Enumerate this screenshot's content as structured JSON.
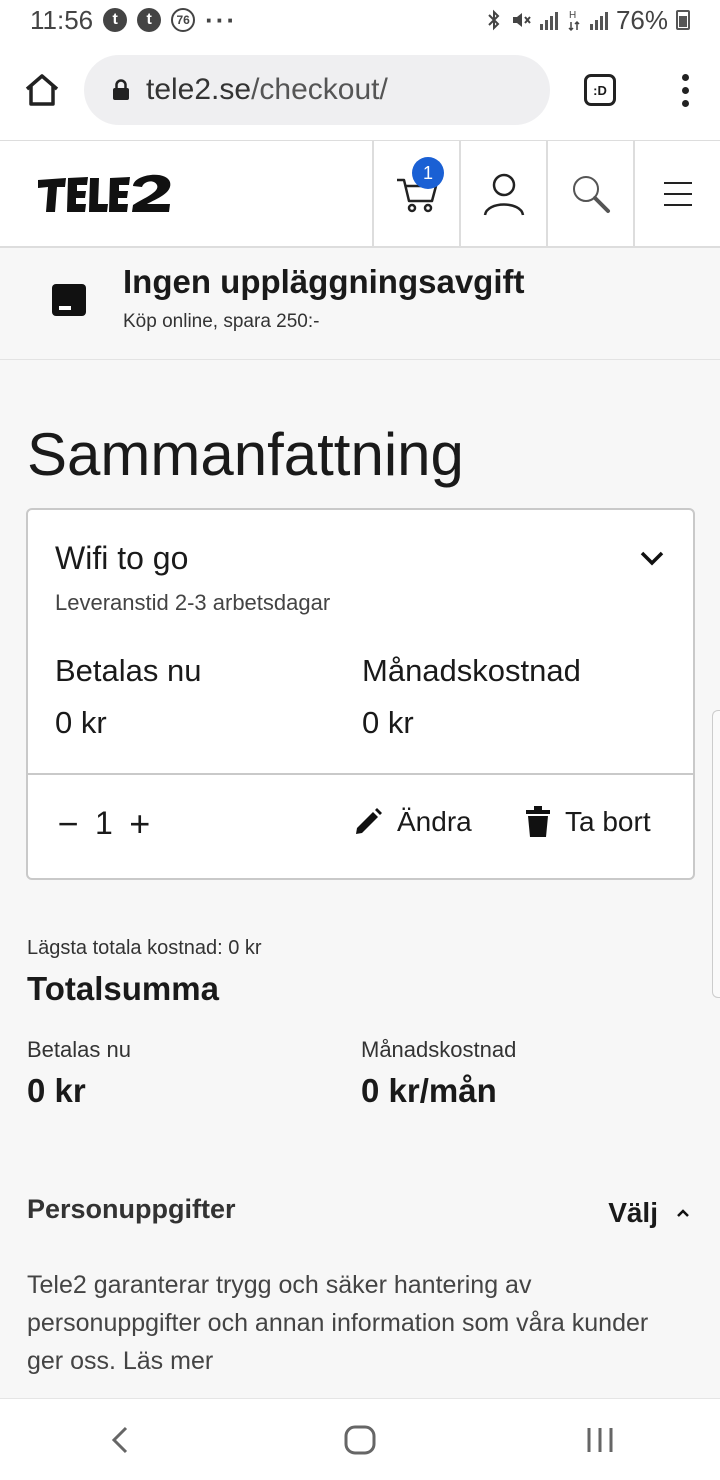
{
  "status": {
    "time": "11:56",
    "badges": [
      "t",
      "t"
    ],
    "notif_count": "76",
    "more": "···",
    "battery": "76%"
  },
  "browser": {
    "url_host": "tele2.se",
    "url_path": "/checkout/",
    "tab_label": ":D"
  },
  "header": {
    "cart_count": "1"
  },
  "promo": {
    "title": "Ingen uppläggningsavgift",
    "subtitle": "Köp online, spara 250:-"
  },
  "page": {
    "title": "Sammanfattning"
  },
  "item": {
    "name": "Wifi to go",
    "delivery": "Leveranstid 2-3 arbetsdagar",
    "pay_now_label": "Betalas nu",
    "pay_now_value": "0 kr",
    "monthly_label": "Månadskostnad",
    "monthly_value": "0 kr",
    "quantity": "1",
    "minus": "−",
    "plus": "+",
    "edit_label": "Ändra",
    "remove_label": "Ta bort"
  },
  "totals": {
    "lowest_cost": "Lägsta totala kostnad: 0 kr",
    "title": "Totalsumma",
    "pay_now_label": "Betalas nu",
    "pay_now_value": "0 kr",
    "monthly_label": "Månadskostnad",
    "monthly_value": "0 kr/mån"
  },
  "personal": {
    "title": "Personuppgifter",
    "action": "Välj",
    "text": "Tele2 garanterar trygg och säker hantering av personuppgifter och annan information som våra kunder ger oss. Läs mer"
  },
  "colors": {
    "accent": "#1a60d4",
    "border": "#c9c9c9",
    "background": "#f7f7f7"
  }
}
